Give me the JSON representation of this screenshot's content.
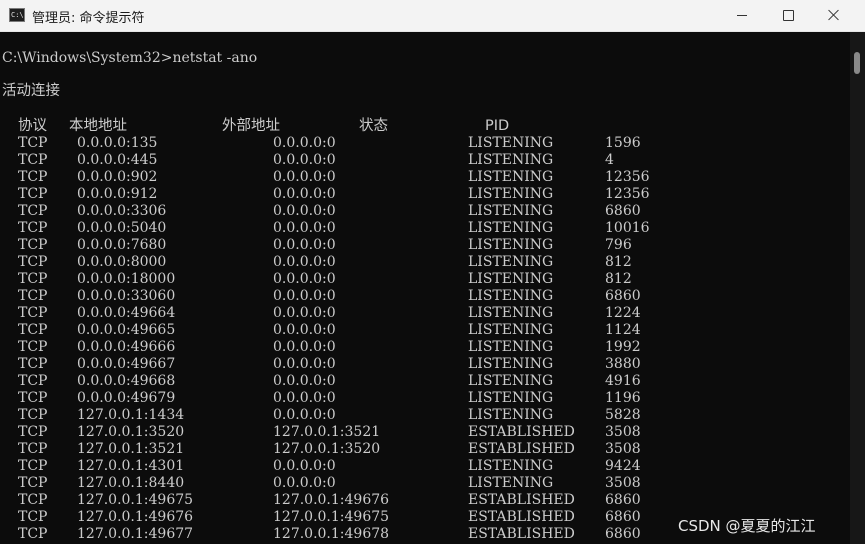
{
  "window": {
    "title": "管理员: 命令提示符",
    "icon": "cmd-icon",
    "minimize_icon": "minimize-icon",
    "maximize_icon": "maximize-icon",
    "close_icon": "close-icon"
  },
  "console": {
    "command_line": "C:\\Windows\\System32>netstat -ano",
    "section_title": "活动连接",
    "headers": [
      "协议",
      "本地地址",
      "外部地址",
      "状态",
      "PID"
    ],
    "rows": [
      [
        "TCP",
        "0.0.0.0:135",
        "0.0.0.0:0",
        "LISTENING",
        "1596"
      ],
      [
        "TCP",
        "0.0.0.0:445",
        "0.0.0.0:0",
        "LISTENING",
        "4"
      ],
      [
        "TCP",
        "0.0.0.0:902",
        "0.0.0.0:0",
        "LISTENING",
        "12356"
      ],
      [
        "TCP",
        "0.0.0.0:912",
        "0.0.0.0:0",
        "LISTENING",
        "12356"
      ],
      [
        "TCP",
        "0.0.0.0:3306",
        "0.0.0.0:0",
        "LISTENING",
        "6860"
      ],
      [
        "TCP",
        "0.0.0.0:5040",
        "0.0.0.0:0",
        "LISTENING",
        "10016"
      ],
      [
        "TCP",
        "0.0.0.0:7680",
        "0.0.0.0:0",
        "LISTENING",
        "796"
      ],
      [
        "TCP",
        "0.0.0.0:8000",
        "0.0.0.0:0",
        "LISTENING",
        "812"
      ],
      [
        "TCP",
        "0.0.0.0:18000",
        "0.0.0.0:0",
        "LISTENING",
        "812"
      ],
      [
        "TCP",
        "0.0.0.0:33060",
        "0.0.0.0:0",
        "LISTENING",
        "6860"
      ],
      [
        "TCP",
        "0.0.0.0:49664",
        "0.0.0.0:0",
        "LISTENING",
        "1224"
      ],
      [
        "TCP",
        "0.0.0.0:49665",
        "0.0.0.0:0",
        "LISTENING",
        "1124"
      ],
      [
        "TCP",
        "0.0.0.0:49666",
        "0.0.0.0:0",
        "LISTENING",
        "1992"
      ],
      [
        "TCP",
        "0.0.0.0:49667",
        "0.0.0.0:0",
        "LISTENING",
        "3880"
      ],
      [
        "TCP",
        "0.0.0.0:49668",
        "0.0.0.0:0",
        "LISTENING",
        "4916"
      ],
      [
        "TCP",
        "0.0.0.0:49679",
        "0.0.0.0:0",
        "LISTENING",
        "1196"
      ],
      [
        "TCP",
        "127.0.0.1:1434",
        "0.0.0.0:0",
        "LISTENING",
        "5828"
      ],
      [
        "TCP",
        "127.0.0.1:3520",
        "127.0.0.1:3521",
        "ESTABLISHED",
        "3508"
      ],
      [
        "TCP",
        "127.0.0.1:3521",
        "127.0.0.1:3520",
        "ESTABLISHED",
        "3508"
      ],
      [
        "TCP",
        "127.0.0.1:4301",
        "0.0.0.0:0",
        "LISTENING",
        "9424"
      ],
      [
        "TCP",
        "127.0.0.1:8440",
        "0.0.0.0:0",
        "LISTENING",
        "3508"
      ],
      [
        "TCP",
        "127.0.0.1:49675",
        "127.0.0.1:49676",
        "ESTABLISHED",
        "6860"
      ],
      [
        "TCP",
        "127.0.0.1:49676",
        "127.0.0.1:49675",
        "ESTABLISHED",
        "6860"
      ],
      [
        "TCP",
        "127.0.0.1:49677",
        "127.0.0.1:49678",
        "ESTABLISHED",
        "6860"
      ]
    ]
  },
  "watermark": "CSDN @夏夏的江江",
  "colors": {
    "console_bg": "#0c0c0c",
    "console_text": "#cccccc",
    "titlebar_bg": "#f3f3f3"
  }
}
